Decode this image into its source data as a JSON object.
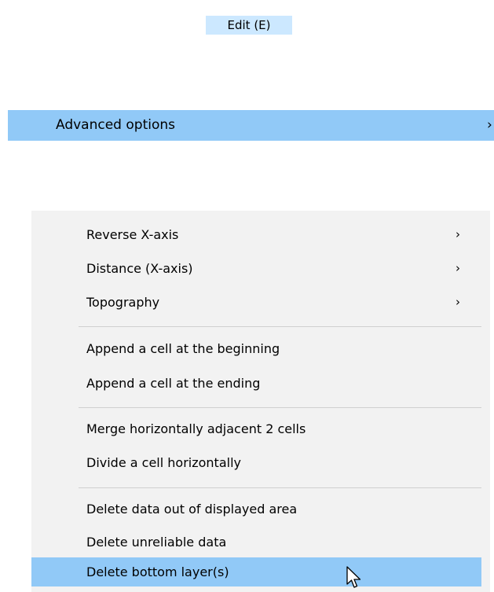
{
  "top_menu": {
    "edit_label": "Edit (E)"
  },
  "submenu_row": {
    "label": "Advanced options",
    "chevron": "›"
  },
  "context_menu": {
    "items": [
      {
        "label": "Reverse X-axis",
        "chevron": "›"
      },
      {
        "label": "Distance (X-axis)",
        "chevron": "›"
      },
      {
        "label": "Topography",
        "chevron": "›"
      },
      {
        "label": "Append a cell at the beginning"
      },
      {
        "label": "Append a cell at the ending"
      },
      {
        "label": "Merge horizontally adjacent 2 cells"
      },
      {
        "label": "Divide a cell horizontally"
      },
      {
        "label": "Delete data out of displayed area"
      },
      {
        "label": "Delete unreliable data"
      },
      {
        "label": "Delete bottom layer(s)"
      }
    ],
    "highlighted_item": "Delete bottom layer(s)"
  },
  "colors": {
    "menu_bar_highlight": "#cce8ff",
    "menu_item_highlight": "#91c9f7",
    "menu_background": "#f2f2f2",
    "separator": "#cfcfcf"
  },
  "icons": {
    "cursor": "mouse-pointer-icon",
    "chevron": "chevron-right-icon"
  }
}
